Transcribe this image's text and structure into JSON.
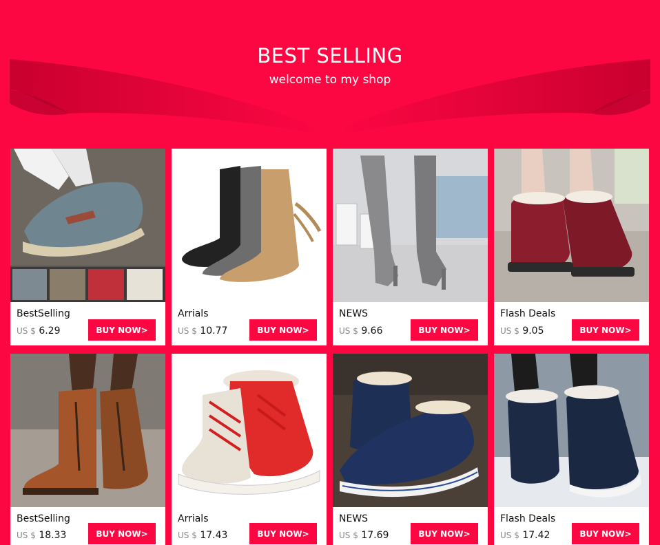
{
  "banner": {
    "title": "BEST SELLING",
    "subtitle": "welcome to my shop"
  },
  "colors": {
    "accent": "#fd0743",
    "card_bg": "#ffffff"
  },
  "products": [
    {
      "category": "BestSelling",
      "currency": "US $",
      "price": "6.29",
      "button": "BUY NOW>",
      "image": "grey slip-on sneaker"
    },
    {
      "category": "Arrials",
      "currency": "US $",
      "price": "10.77",
      "button": "BUY NOW>",
      "image": "mid-calf slouch boots"
    },
    {
      "category": "NEWS",
      "currency": "US $",
      "price": "9.66",
      "button": "BUY NOW>",
      "image": "grey knee-high heeled boots"
    },
    {
      "category": "Flash Deals",
      "currency": "US $",
      "price": "9.05",
      "button": "BUY NOW>",
      "image": "burgundy fur lace-up boots"
    },
    {
      "category": "BestSelling",
      "currency": "US $",
      "price": "18.33",
      "button": "BUY NOW>",
      "image": "brown leather lace-up boots"
    },
    {
      "category": "Arrials",
      "currency": "US $",
      "price": "17.43",
      "button": "BUY NOW>",
      "image": "red and white snow boots"
    },
    {
      "category": "NEWS",
      "currency": "US $",
      "price": "17.69",
      "button": "BUY NOW>",
      "image": "navy fur-lined sneakers"
    },
    {
      "category": "Flash Deals",
      "currency": "US $",
      "price": "17.42",
      "button": "BUY NOW>",
      "image": "navy snow boots"
    }
  ]
}
